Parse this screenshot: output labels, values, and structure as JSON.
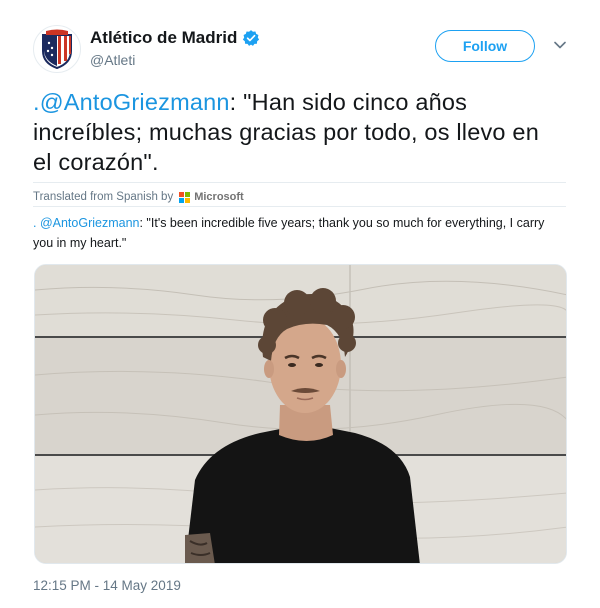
{
  "author": {
    "name": "Atlético de Madrid",
    "handle": "@Atleti",
    "verified": true,
    "avatar_icon": "club-crest-icon"
  },
  "actions": {
    "follow_label": "Follow",
    "more_icon": "chevron-down-icon"
  },
  "tweet": {
    "mention": ".@AntoGriezmann",
    "text": ": \"Han sido cinco años increíbles; muchas gracias por todo, os llevo en el corazón\"."
  },
  "translation": {
    "label": "Translated from Spanish by",
    "provider": "Microsoft",
    "mention": ". @AntoGriezmann",
    "text": ": \"It's been incredible five years; thank you so much for everything, I carry you in my heart.\""
  },
  "media": {
    "type": "video",
    "icon": "player-portrait-image"
  },
  "timestamp": "12:15 PM - 14 May 2019",
  "colors": {
    "link": "#1b95e0",
    "follow": "#1da1f2",
    "verified": "#1da1f2",
    "secondary_text": "#657786"
  }
}
